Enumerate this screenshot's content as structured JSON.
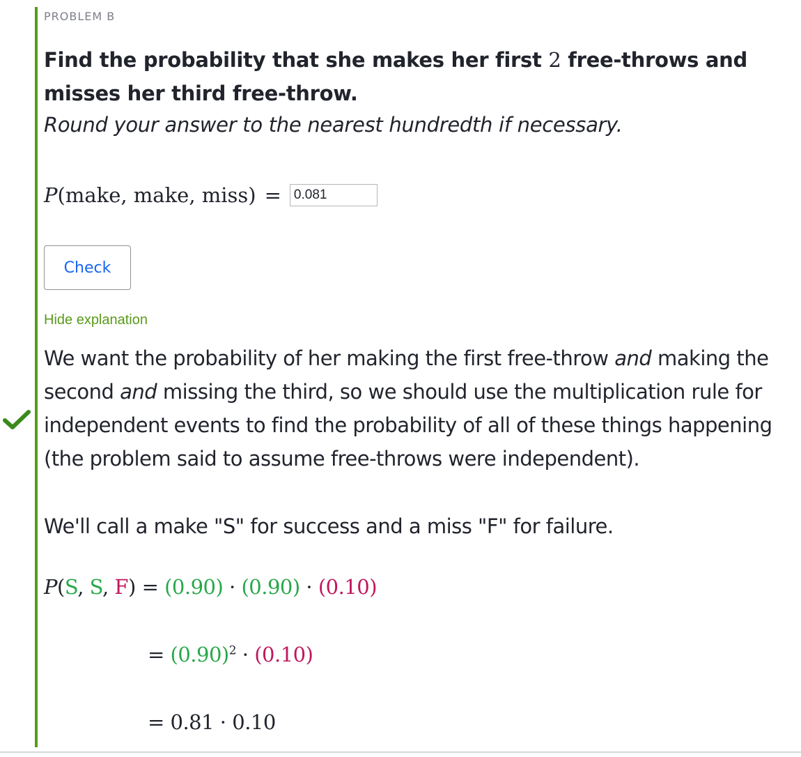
{
  "problem_label": "PROBLEM B",
  "question": {
    "part1": "Find the probability that she makes her first ",
    "number": "2",
    "part2": " free-throws and misses her third free-throw.",
    "instruction": "Round your answer to the nearest hundredth if necessary."
  },
  "answer": {
    "lhs_p": "P",
    "lhs_args": "(make, make, miss)",
    "equals": "=",
    "value": "0.081"
  },
  "check_button": "Check",
  "hide_explanation": "Hide explanation",
  "explanation": {
    "para1_a": "We want the probability of her making the first free-throw ",
    "and1": "and",
    "para1_b": " making the second ",
    "and2": "and",
    "para1_c": " missing the third, so we should use the multiplication rule for independent events to find the probability of all of these things happening (the problem said to assume free-throws were independent).",
    "para2": "We'll call a make \"S\" for success and a miss \"F\" for failure.",
    "eq1": {
      "p": "P",
      "open": "(",
      "s1": "S",
      "comma1": ", ",
      "s2": "S",
      "comma2": ", ",
      "f": "F",
      "close": ")",
      "eq": " = ",
      "t1": "(0.90)",
      "dot1": " · ",
      "t2": "(0.90)",
      "dot2": " · ",
      "t3": "(0.10)"
    },
    "eq2": {
      "eq": "= ",
      "base": "(0.90)",
      "exp": "2",
      "dot": " · ",
      "t": "(0.10)"
    },
    "eq3": "= 0.81 · 0.10"
  },
  "colors": {
    "success": "#28a84a",
    "failure": "#c0175d",
    "accent_bar": "#5a9a1a",
    "link": "#1865f2"
  }
}
